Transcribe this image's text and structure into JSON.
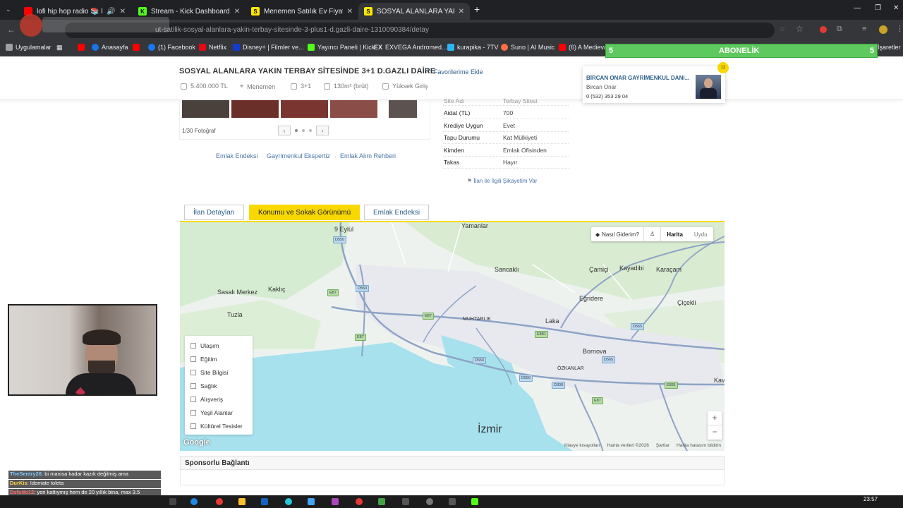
{
  "browser": {
    "tabs": [
      {
        "label": "lofi hip hop radio 📚 beats",
        "favicon_color": "#ff0000",
        "active": false
      },
      {
        "label": "Stream - Kick Dashboard",
        "favicon_color": "#53fc18",
        "active": false
      },
      {
        "label": "Menemen Satılık Ev Fiyatları sa",
        "favicon_color": "#ffe800",
        "active": false
      },
      {
        "label": "SOSYAL ALANLARA YAKIN TERI",
        "favicon_color": "#ffe800",
        "active": true
      }
    ],
    "url": "ut-satilik-sosyal-alanlara-yakin-terbay-sitesinde-3-plus1-d.gazli-daire-1310090384/detay",
    "bookmarks": [
      {
        "label": "Uygulamalar"
      },
      {
        "label": "Anasayfa"
      },
      {
        "label": "(1) Facebook"
      },
      {
        "label": "Netflix"
      },
      {
        "label": "Disney+ | Filmler ve..."
      },
      {
        "label": "Yayıncı Paneli | Kick"
      },
      {
        "label": "EXVEGA Andromed..."
      },
      {
        "label": "kurapika - 7TV"
      },
      {
        "label": "Suno | AI Music"
      },
      {
        "label": "(6) A Medieval"
      },
      {
        "label": "İşaretler"
      }
    ]
  },
  "listing": {
    "title": "SOSYAL ALANLARA YAKIN TERBAY SİTESİNDE 3+1 D.GAZLI DAİRE",
    "favorite_label": "Favorilerime Ekle",
    "meta": {
      "price": "5.400.000 TL",
      "location": "Menemen",
      "rooms": "3+1",
      "area": "130m² (brüt)",
      "entrance": "Yüksek Giriş"
    },
    "photo_count": "1/30 Fotoğraf",
    "links": [
      "Emlak Endeksi",
      "Gayrimenkul Ekspertiz",
      "Emlak Alım Rehberi"
    ],
    "info": [
      {
        "key": "Site Adı",
        "value": "Terbay Sitesi"
      },
      {
        "key": "Aidat (TL)",
        "value": "700"
      },
      {
        "key": "Krediye Uygun",
        "value": "Evet"
      },
      {
        "key": "Tapu Durumu",
        "value": "Kat Mülkiyeti"
      },
      {
        "key": "Kimden",
        "value": "Emlak Ofisinden"
      },
      {
        "key": "Takas",
        "value": "Hayır"
      }
    ],
    "complaint_link": "İlan ile İlgili Şikayetim Var",
    "tabs": [
      "İlan Detayları",
      "Konumu ve Sokak Görünümü",
      "Emlak Endeksi"
    ],
    "sponsor_title": "Sponsorlu Bağlantı"
  },
  "agent": {
    "company": "BİRCAN ONAR GAYRİMENKUL DANI...",
    "name": "Bircan Onar",
    "phone": "0 (532) 353 29 04"
  },
  "map": {
    "controls": {
      "directions": "Nasıl Giderim?",
      "map": "Harita",
      "satellite": "Uydu"
    },
    "places": [
      "9 Eylül",
      "Yamanlar",
      "Sancaklı",
      "Çamiçi",
      "Kayadibi",
      "Karaçam",
      "Sasalı Merkez",
      "Kaklıç",
      "Tuzla",
      "Eğridere",
      "Çiçekli",
      "MUHTARLIK",
      "Laka",
      "Bornova",
      "ÖZKANLAR",
      "İzmir",
      "Kav"
    ],
    "roads": [
      "D550",
      "D550",
      "E87",
      "E87",
      "E87",
      "D565",
      "D550",
      "D550",
      "D300",
      "E881",
      "D565",
      "E881",
      "E87"
    ],
    "legend": [
      "Ulaşım",
      "Eğitim",
      "Site Bilgisi",
      "Sağlık",
      "Alışveriş",
      "Yeşil Alanlar",
      "Kültürel Tesisler"
    ],
    "zoom_in": "+",
    "zoom_out": "−",
    "attribution": [
      "Klavye kısayolları",
      "Harita verileri ©2026",
      "Şartlar",
      "Harita hatasını bildirin"
    ],
    "google": "Google",
    "water_colour": "#a6e1ed",
    "land_colour": "#eef2ef",
    "green_colour": "#d6ecd2"
  },
  "overlay": {
    "subscription_label": "ABONELİK",
    "sub_left": "5",
    "sub_right": "5",
    "chat": [
      {
        "user": "TheSentry26",
        "text": "bi manisa kadar kazık değilmiş ama"
      },
      {
        "user": "DurKis",
        "text": "Idomate toleta"
      },
      {
        "user": "Dsfudo12",
        "text": "yeri kattıymış hem de 20 yıllık bina, max 3.5"
      }
    ],
    "badge": "12",
    "clock": "23:57"
  }
}
